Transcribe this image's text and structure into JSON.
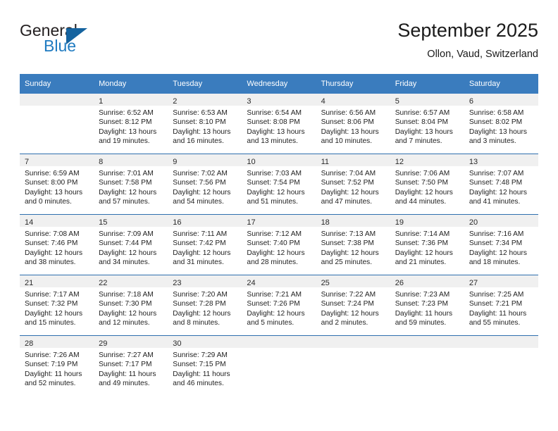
{
  "brand": {
    "name_top": "General",
    "name_bottom": "Blue",
    "triangle_color": "#15639f",
    "blue_text_color": "#1f7bc1"
  },
  "header": {
    "title": "September 2025",
    "subtitle": "Ollon, Vaud, Switzerland"
  },
  "theme": {
    "header_blue": "#3a7cbe",
    "row_divider": "#2f6fae",
    "daynum_band": "#f0f0f0"
  },
  "weekday_headers": [
    "Sunday",
    "Monday",
    "Tuesday",
    "Wednesday",
    "Thursday",
    "Friday",
    "Saturday"
  ],
  "weeks": [
    [
      {
        "day": "",
        "lines": []
      },
      {
        "day": "1",
        "lines": [
          "Sunrise: 6:52 AM",
          "Sunset: 8:12 PM",
          "Daylight: 13 hours",
          "and 19 minutes."
        ]
      },
      {
        "day": "2",
        "lines": [
          "Sunrise: 6:53 AM",
          "Sunset: 8:10 PM",
          "Daylight: 13 hours",
          "and 16 minutes."
        ]
      },
      {
        "day": "3",
        "lines": [
          "Sunrise: 6:54 AM",
          "Sunset: 8:08 PM",
          "Daylight: 13 hours",
          "and 13 minutes."
        ]
      },
      {
        "day": "4",
        "lines": [
          "Sunrise: 6:56 AM",
          "Sunset: 8:06 PM",
          "Daylight: 13 hours",
          "and 10 minutes."
        ]
      },
      {
        "day": "5",
        "lines": [
          "Sunrise: 6:57 AM",
          "Sunset: 8:04 PM",
          "Daylight: 13 hours",
          "and 7 minutes."
        ]
      },
      {
        "day": "6",
        "lines": [
          "Sunrise: 6:58 AM",
          "Sunset: 8:02 PM",
          "Daylight: 13 hours",
          "and 3 minutes."
        ]
      }
    ],
    [
      {
        "day": "7",
        "lines": [
          "Sunrise: 6:59 AM",
          "Sunset: 8:00 PM",
          "Daylight: 13 hours",
          "and 0 minutes."
        ]
      },
      {
        "day": "8",
        "lines": [
          "Sunrise: 7:01 AM",
          "Sunset: 7:58 PM",
          "Daylight: 12 hours",
          "and 57 minutes."
        ]
      },
      {
        "day": "9",
        "lines": [
          "Sunrise: 7:02 AM",
          "Sunset: 7:56 PM",
          "Daylight: 12 hours",
          "and 54 minutes."
        ]
      },
      {
        "day": "10",
        "lines": [
          "Sunrise: 7:03 AM",
          "Sunset: 7:54 PM",
          "Daylight: 12 hours",
          "and 51 minutes."
        ]
      },
      {
        "day": "11",
        "lines": [
          "Sunrise: 7:04 AM",
          "Sunset: 7:52 PM",
          "Daylight: 12 hours",
          "and 47 minutes."
        ]
      },
      {
        "day": "12",
        "lines": [
          "Sunrise: 7:06 AM",
          "Sunset: 7:50 PM",
          "Daylight: 12 hours",
          "and 44 minutes."
        ]
      },
      {
        "day": "13",
        "lines": [
          "Sunrise: 7:07 AM",
          "Sunset: 7:48 PM",
          "Daylight: 12 hours",
          "and 41 minutes."
        ]
      }
    ],
    [
      {
        "day": "14",
        "lines": [
          "Sunrise: 7:08 AM",
          "Sunset: 7:46 PM",
          "Daylight: 12 hours",
          "and 38 minutes."
        ]
      },
      {
        "day": "15",
        "lines": [
          "Sunrise: 7:09 AM",
          "Sunset: 7:44 PM",
          "Daylight: 12 hours",
          "and 34 minutes."
        ]
      },
      {
        "day": "16",
        "lines": [
          "Sunrise: 7:11 AM",
          "Sunset: 7:42 PM",
          "Daylight: 12 hours",
          "and 31 minutes."
        ]
      },
      {
        "day": "17",
        "lines": [
          "Sunrise: 7:12 AM",
          "Sunset: 7:40 PM",
          "Daylight: 12 hours",
          "and 28 minutes."
        ]
      },
      {
        "day": "18",
        "lines": [
          "Sunrise: 7:13 AM",
          "Sunset: 7:38 PM",
          "Daylight: 12 hours",
          "and 25 minutes."
        ]
      },
      {
        "day": "19",
        "lines": [
          "Sunrise: 7:14 AM",
          "Sunset: 7:36 PM",
          "Daylight: 12 hours",
          "and 21 minutes."
        ]
      },
      {
        "day": "20",
        "lines": [
          "Sunrise: 7:16 AM",
          "Sunset: 7:34 PM",
          "Daylight: 12 hours",
          "and 18 minutes."
        ]
      }
    ],
    [
      {
        "day": "21",
        "lines": [
          "Sunrise: 7:17 AM",
          "Sunset: 7:32 PM",
          "Daylight: 12 hours",
          "and 15 minutes."
        ]
      },
      {
        "day": "22",
        "lines": [
          "Sunrise: 7:18 AM",
          "Sunset: 7:30 PM",
          "Daylight: 12 hours",
          "and 12 minutes."
        ]
      },
      {
        "day": "23",
        "lines": [
          "Sunrise: 7:20 AM",
          "Sunset: 7:28 PM",
          "Daylight: 12 hours",
          "and 8 minutes."
        ]
      },
      {
        "day": "24",
        "lines": [
          "Sunrise: 7:21 AM",
          "Sunset: 7:26 PM",
          "Daylight: 12 hours",
          "and 5 minutes."
        ]
      },
      {
        "day": "25",
        "lines": [
          "Sunrise: 7:22 AM",
          "Sunset: 7:24 PM",
          "Daylight: 12 hours",
          "and 2 minutes."
        ]
      },
      {
        "day": "26",
        "lines": [
          "Sunrise: 7:23 AM",
          "Sunset: 7:23 PM",
          "Daylight: 11 hours",
          "and 59 minutes."
        ]
      },
      {
        "day": "27",
        "lines": [
          "Sunrise: 7:25 AM",
          "Sunset: 7:21 PM",
          "Daylight: 11 hours",
          "and 55 minutes."
        ]
      }
    ],
    [
      {
        "day": "28",
        "lines": [
          "Sunrise: 7:26 AM",
          "Sunset: 7:19 PM",
          "Daylight: 11 hours",
          "and 52 minutes."
        ]
      },
      {
        "day": "29",
        "lines": [
          "Sunrise: 7:27 AM",
          "Sunset: 7:17 PM",
          "Daylight: 11 hours",
          "and 49 minutes."
        ]
      },
      {
        "day": "30",
        "lines": [
          "Sunrise: 7:29 AM",
          "Sunset: 7:15 PM",
          "Daylight: 11 hours",
          "and 46 minutes."
        ]
      },
      {
        "day": "",
        "lines": []
      },
      {
        "day": "",
        "lines": []
      },
      {
        "day": "",
        "lines": []
      },
      {
        "day": "",
        "lines": []
      }
    ]
  ]
}
